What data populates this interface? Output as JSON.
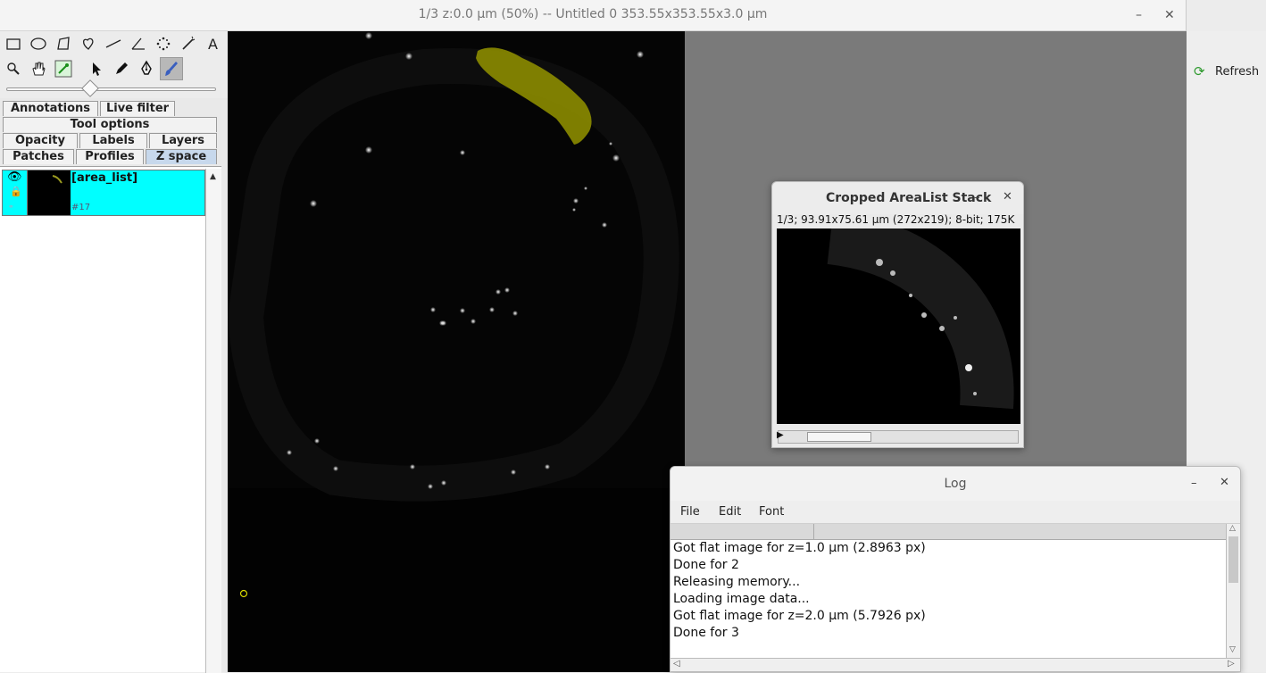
{
  "main_window": {
    "title": "1/3  z:0.0 µm  (50%) -- Untitled 0  353.55x353.55x3.0 µm",
    "minimize": "–",
    "close": "✕"
  },
  "toolbar": {
    "tools": [
      {
        "name": "rectangle-tool-icon",
        "glyph": "▭"
      },
      {
        "name": "oval-tool-icon",
        "glyph": "◯"
      },
      {
        "name": "polygon-tool-icon",
        "glyph": "⬠"
      },
      {
        "name": "freehand-tool-icon",
        "glyph": "♡"
      },
      {
        "name": "line-tool-icon",
        "glyph": "╱"
      },
      {
        "name": "angle-tool-icon",
        "glyph": "∠"
      },
      {
        "name": "point-tool-icon",
        "glyph": "✣"
      },
      {
        "name": "wand-tool-icon",
        "glyph": "⁄"
      },
      {
        "name": "text-tool-icon",
        "glyph": "A"
      },
      {
        "name": "magnifier-tool-icon",
        "glyph": "⚲"
      },
      {
        "name": "hand-tool-icon",
        "glyph": "✋"
      },
      {
        "name": "dropper-tool-icon",
        "glyph": "✎"
      },
      {
        "name": "select-arrow-tool-icon",
        "glyph": "➤"
      },
      {
        "name": "pencil-tool-icon",
        "glyph": "✏"
      },
      {
        "name": "pen-tool-icon",
        "glyph": "✒"
      },
      {
        "name": "brush-tool-icon",
        "glyph": "🖌"
      }
    ]
  },
  "tabs": {
    "annotations": "Annotations",
    "live_filter": "Live filter",
    "tool_options": "Tool options",
    "opacity": "Opacity",
    "labels": "Labels",
    "layers": "Layers",
    "patches": "Patches",
    "profiles": "Profiles",
    "z_space": "Z space"
  },
  "layer_panel": {
    "item_name": "[area_list]",
    "item_id": "#17"
  },
  "right_panel": {
    "refresh": "Refresh"
  },
  "stack_window": {
    "title": "Cropped AreaList Stack",
    "minimize": "–",
    "close": "✕",
    "info": "1/3; 93.91x75.61 µm (272x219); 8-bit; 175K"
  },
  "log_window": {
    "title": "Log",
    "minimize": "–",
    "close": "✕",
    "menu": [
      "File",
      "Edit",
      "Font"
    ],
    "lines": [
      "Got flat image for z=1.0 µm (2.8963 px)",
      "Done for 2",
      "Releasing memory...",
      "Loading image data...",
      "Got flat image for z=2.0 µm (5.7926 px)",
      "Done for 3"
    ]
  },
  "colors": {
    "selected_layer": "#00ffff",
    "area_overlay": "#b5b500",
    "active_tab": "#c7d8ec",
    "canvas": "#020202",
    "canvas_background": "#7a7a7a"
  }
}
